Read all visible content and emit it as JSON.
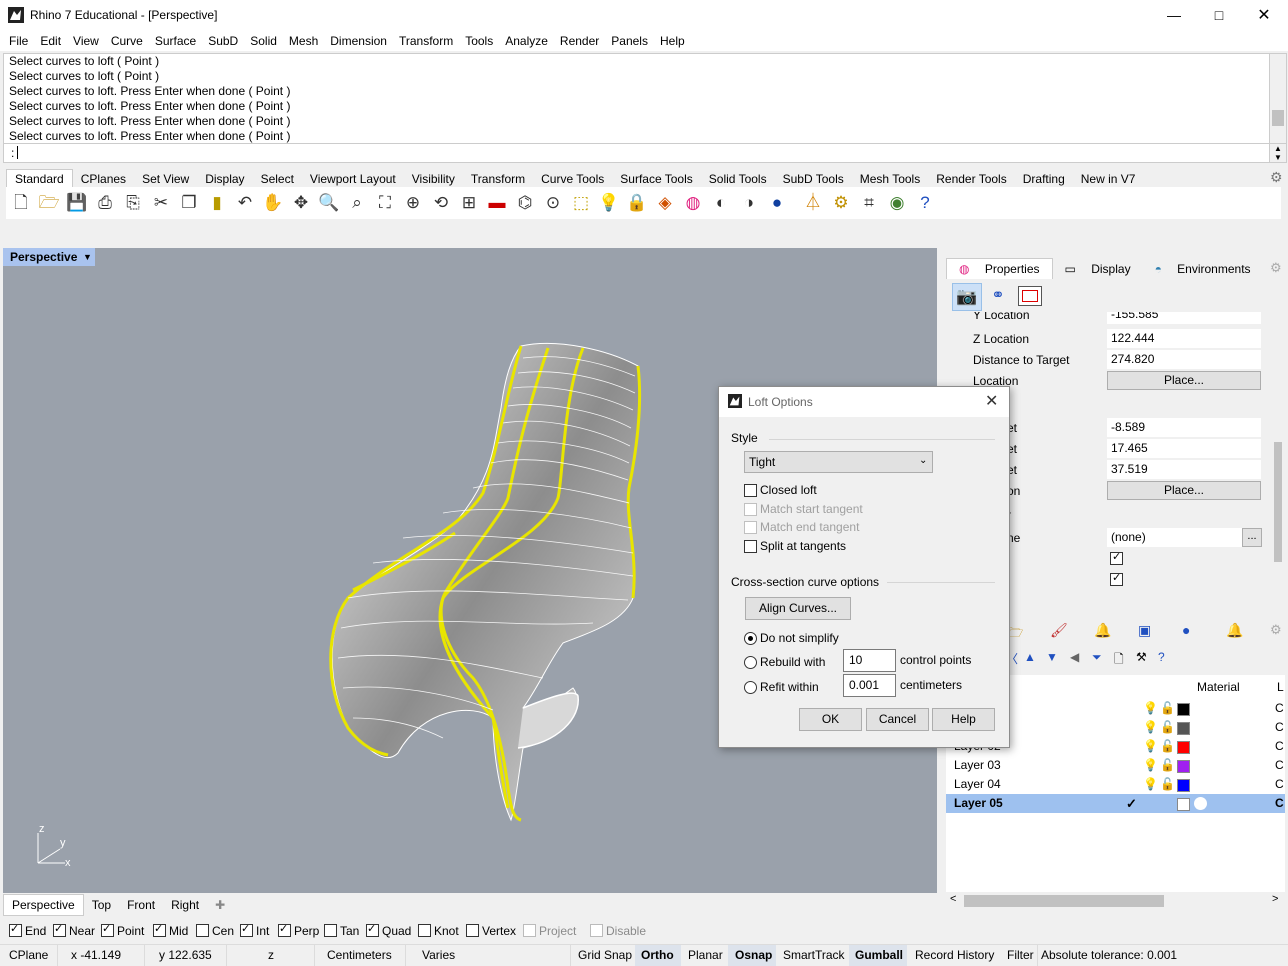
{
  "window": {
    "title": "Rhino 7 Educational - [Perspective]"
  },
  "menu": [
    "File",
    "Edit",
    "View",
    "Curve",
    "Surface",
    "SubD",
    "Solid",
    "Mesh",
    "Dimension",
    "Transform",
    "Tools",
    "Analyze",
    "Render",
    "Panels",
    "Help"
  ],
  "command_history": [
    "Select curves to loft ( Point )",
    "Select curves to loft ( Point )",
    "Select curves to loft. Press Enter when done ( Point )",
    "Select curves to loft. Press Enter when done ( Point )",
    "Select curves to loft. Press Enter when done ( Point )",
    "Select curves to loft. Press Enter when done ( Point )"
  ],
  "command_prompt": ":",
  "toolbar_tabs": [
    "Standard",
    "CPlanes",
    "Set View",
    "Display",
    "Select",
    "Viewport Layout",
    "Visibility",
    "Transform",
    "Curve Tools",
    "Surface Tools",
    "Solid Tools",
    "SubD Tools",
    "Mesh Tools",
    "Render Tools",
    "Drafting",
    "New in V7"
  ],
  "viewport": {
    "title": "Perspective",
    "tabs": [
      "Perspective",
      "Top",
      "Front",
      "Right"
    ],
    "axes": {
      "z": "z",
      "y": "y",
      "x": "x"
    }
  },
  "panel": {
    "tabs": [
      "Properties",
      "Display",
      "Environments"
    ],
    "rows": [
      {
        "label": "Y Location",
        "value": "-155.585"
      },
      {
        "label": "Z Location",
        "value": "122.444"
      },
      {
        "label": "Distance to Target",
        "value": "274.820"
      },
      {
        "label": "Location",
        "button": "Place..."
      }
    ],
    "target_values": [
      "-8.589",
      "17.465",
      "37.519"
    ],
    "target_partial_labels": [
      "et",
      "et",
      "et"
    ],
    "target_location_partial": "on",
    "target_button": "Place...",
    "partial_r": "r",
    "wallpaper_partial": "ne",
    "wallpaper_value": "(none)",
    "ellipsis": "..."
  },
  "layers": {
    "header_material": "Material",
    "header_l": "L",
    "rows": [
      {
        "name": "",
        "color": "#000000",
        "col_c": "C"
      },
      {
        "name": "",
        "color": "#555555",
        "col_c": "C"
      },
      {
        "name": "Layer 02",
        "color": "#ff0000",
        "col_c": "C"
      },
      {
        "name": "Layer 03",
        "color": "#a020f0",
        "col_c": "C"
      },
      {
        "name": "Layer 04",
        "color": "#0000ff",
        "col_c": "C"
      },
      {
        "name": "Layer 05",
        "color": "#ffffff",
        "col_c": "C",
        "current": true
      }
    ]
  },
  "dialog": {
    "title": "Loft Options",
    "style_label": "Style",
    "style_value": "Tight",
    "closed_loft": "Closed loft",
    "match_start": "Match start tangent",
    "match_end": "Match end tangent",
    "split_tangents": "Split at tangents",
    "cross_section_label": "Cross-section curve options",
    "align_button": "Align Curves...",
    "do_not_simplify": "Do not simplify",
    "rebuild_with": "Rebuild with",
    "rebuild_value": "10",
    "rebuild_unit": "control points",
    "refit_within": "Refit within",
    "refit_value": "0.001",
    "refit_unit": "centimeters",
    "ok": "OK",
    "cancel": "Cancel",
    "help": "Help"
  },
  "osnaps": [
    {
      "label": "End",
      "checked": true
    },
    {
      "label": "Near",
      "checked": true
    },
    {
      "label": "Point",
      "checked": true
    },
    {
      "label": "Mid",
      "checked": true
    },
    {
      "label": "Cen",
      "checked": false
    },
    {
      "label": "Int",
      "checked": true
    },
    {
      "label": "Perp",
      "checked": true
    },
    {
      "label": "Tan",
      "checked": false
    },
    {
      "label": "Quad",
      "checked": true
    },
    {
      "label": "Knot",
      "checked": false
    },
    {
      "label": "Vertex",
      "checked": false
    },
    {
      "label": "Project",
      "checked": false,
      "disabled": true
    },
    {
      "label": "Disable",
      "checked": false,
      "disabled": true
    }
  ],
  "status": {
    "cplane": "CPlane",
    "x": "x -41.149",
    "y": "y 122.635",
    "z": "z",
    "units": "Centimeters",
    "layer": "Varies",
    "grid_snap": "Grid Snap",
    "ortho": "Ortho",
    "planar": "Planar",
    "osnap": "Osnap",
    "smarttrack": "SmartTrack",
    "gumball": "Gumball",
    "record_history": "Record History",
    "filter": "Filter",
    "tolerance": "Absolute tolerance: 0.001"
  }
}
